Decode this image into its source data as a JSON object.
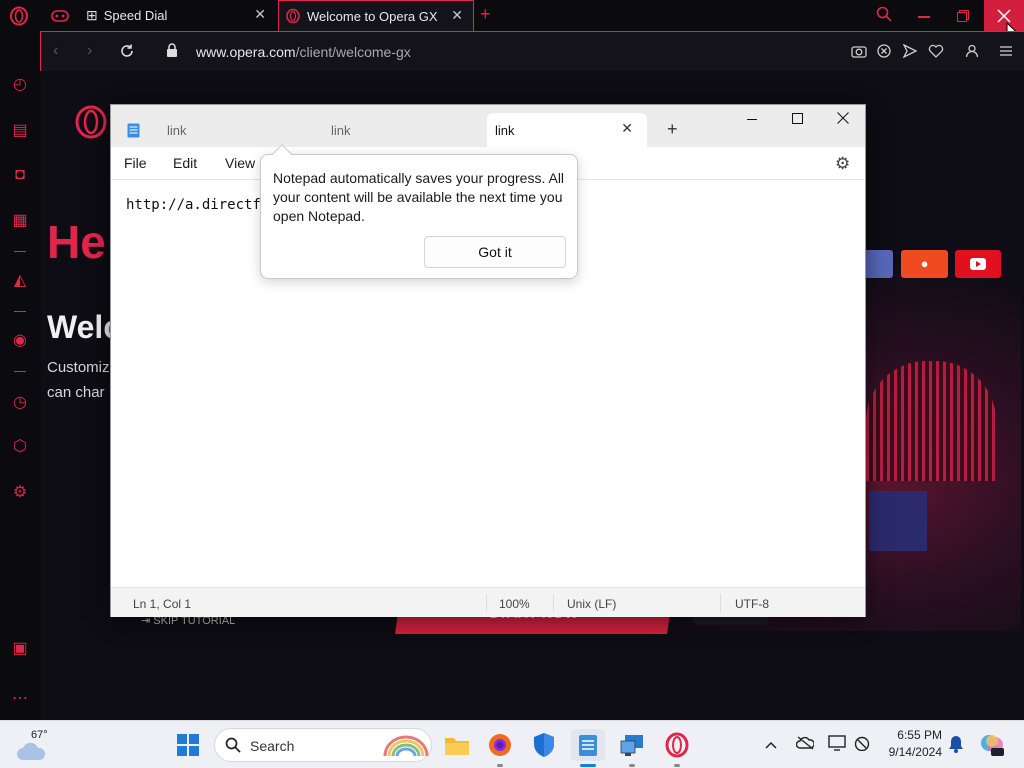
{
  "browser": {
    "tabs": [
      {
        "label": "Speed Dial"
      },
      {
        "label": "Welcome to Opera GX"
      }
    ],
    "url_domain": "www.opera.com",
    "url_path": "/client/welcome-gx"
  },
  "page": {
    "headline_fragment": "He",
    "welcome_fragment": "Welc",
    "line1_fragment": "Customiz",
    "line2_fragment": "can char",
    "skip_label": "SKIP TUTORIAL",
    "start_label": "START NOW"
  },
  "notepad": {
    "tabs": [
      {
        "label": "link"
      },
      {
        "label": "link"
      },
      {
        "label": "link"
      }
    ],
    "menu": [
      "File",
      "Edit",
      "View"
    ],
    "content": "http://a.directfi",
    "status": {
      "position": "Ln 1, Col 1",
      "zoom": "100%",
      "line_ending": "Unix (LF)",
      "encoding": "UTF-8"
    }
  },
  "tip": {
    "message": "Notepad automatically saves your progress. All your content will be available the next time you open Notepad.",
    "button": "Got it"
  },
  "taskbar": {
    "weather_temp": "67°",
    "search_placeholder": "Search",
    "time": "6:55 PM",
    "date": "9/14/2024"
  },
  "colors": {
    "accent": "#e0264a",
    "taskbar_bg": "#eef0f5"
  }
}
